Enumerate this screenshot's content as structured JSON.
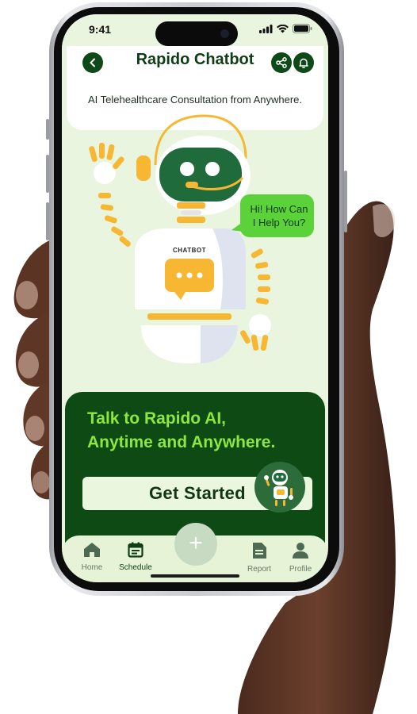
{
  "status_bar": {
    "time": "9:41"
  },
  "header": {
    "title": "Rapido Chatbot",
    "subtitle": "AI Telehealthcare Consultation from Anywhere."
  },
  "hero": {
    "bubble_line1": "Hi! How Can",
    "bubble_line2": "I Help You?",
    "robot_chest_label": "CHATBOT"
  },
  "promo": {
    "title_line1": "Talk to Rapido AI,",
    "title_line2": "Anytime and Anywhere.",
    "cta_label": "Get Started"
  },
  "nav": {
    "items": [
      {
        "label": "Home",
        "icon": "home-icon"
      },
      {
        "label": "Schedule",
        "icon": "calendar-icon",
        "active": true
      },
      {
        "label": "Report",
        "icon": "document-icon"
      },
      {
        "label": "Profile",
        "icon": "person-icon"
      }
    ],
    "fab_label": "+"
  },
  "colors": {
    "brand_dark": "#0d4a14",
    "brand_green": "#5bd13a",
    "accent_lime": "#8fe63e",
    "robot_orange": "#f7b733",
    "screen_bg": "#e9f5de"
  }
}
